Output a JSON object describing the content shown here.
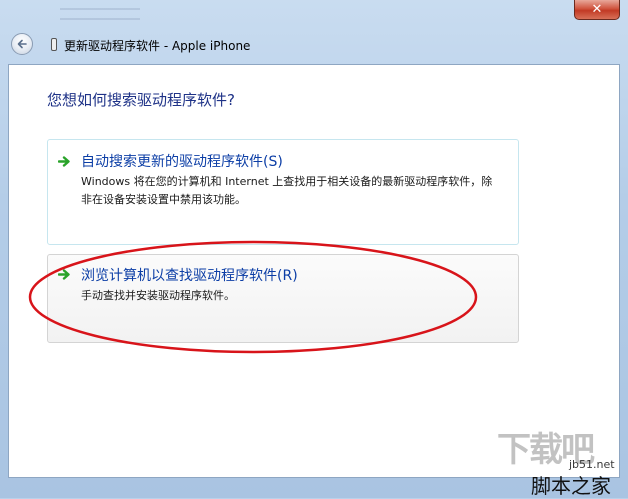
{
  "window": {
    "title": "更新驱动程序软件 - Apple iPhone",
    "close_label": "✕"
  },
  "main": {
    "question": "您想如何搜索驱动程序软件?",
    "options": [
      {
        "title": "自动搜索更新的驱动程序软件(S)",
        "description": "Windows 将在您的计算机和 Internet 上查找用于相关设备的最新驱动程序软件，除非在设备安装设置中禁用该功能。"
      },
      {
        "title": "浏览计算机以查找驱动程序软件(R)",
        "description": "手动查找并安装驱动程序软件。"
      }
    ]
  },
  "watermark": {
    "logo": "下载吧",
    "url": "jb51.net",
    "name": "脚本之家"
  },
  "colors": {
    "question_text": "#1e3287",
    "option_title": "#0c3ea6",
    "arrow_green": "#2aa32a",
    "annotation_red": "#d8141a"
  },
  "icons": {
    "back": "back-arrow-icon",
    "device": "phone-icon",
    "option_arrow": "green-arrow-icon"
  }
}
